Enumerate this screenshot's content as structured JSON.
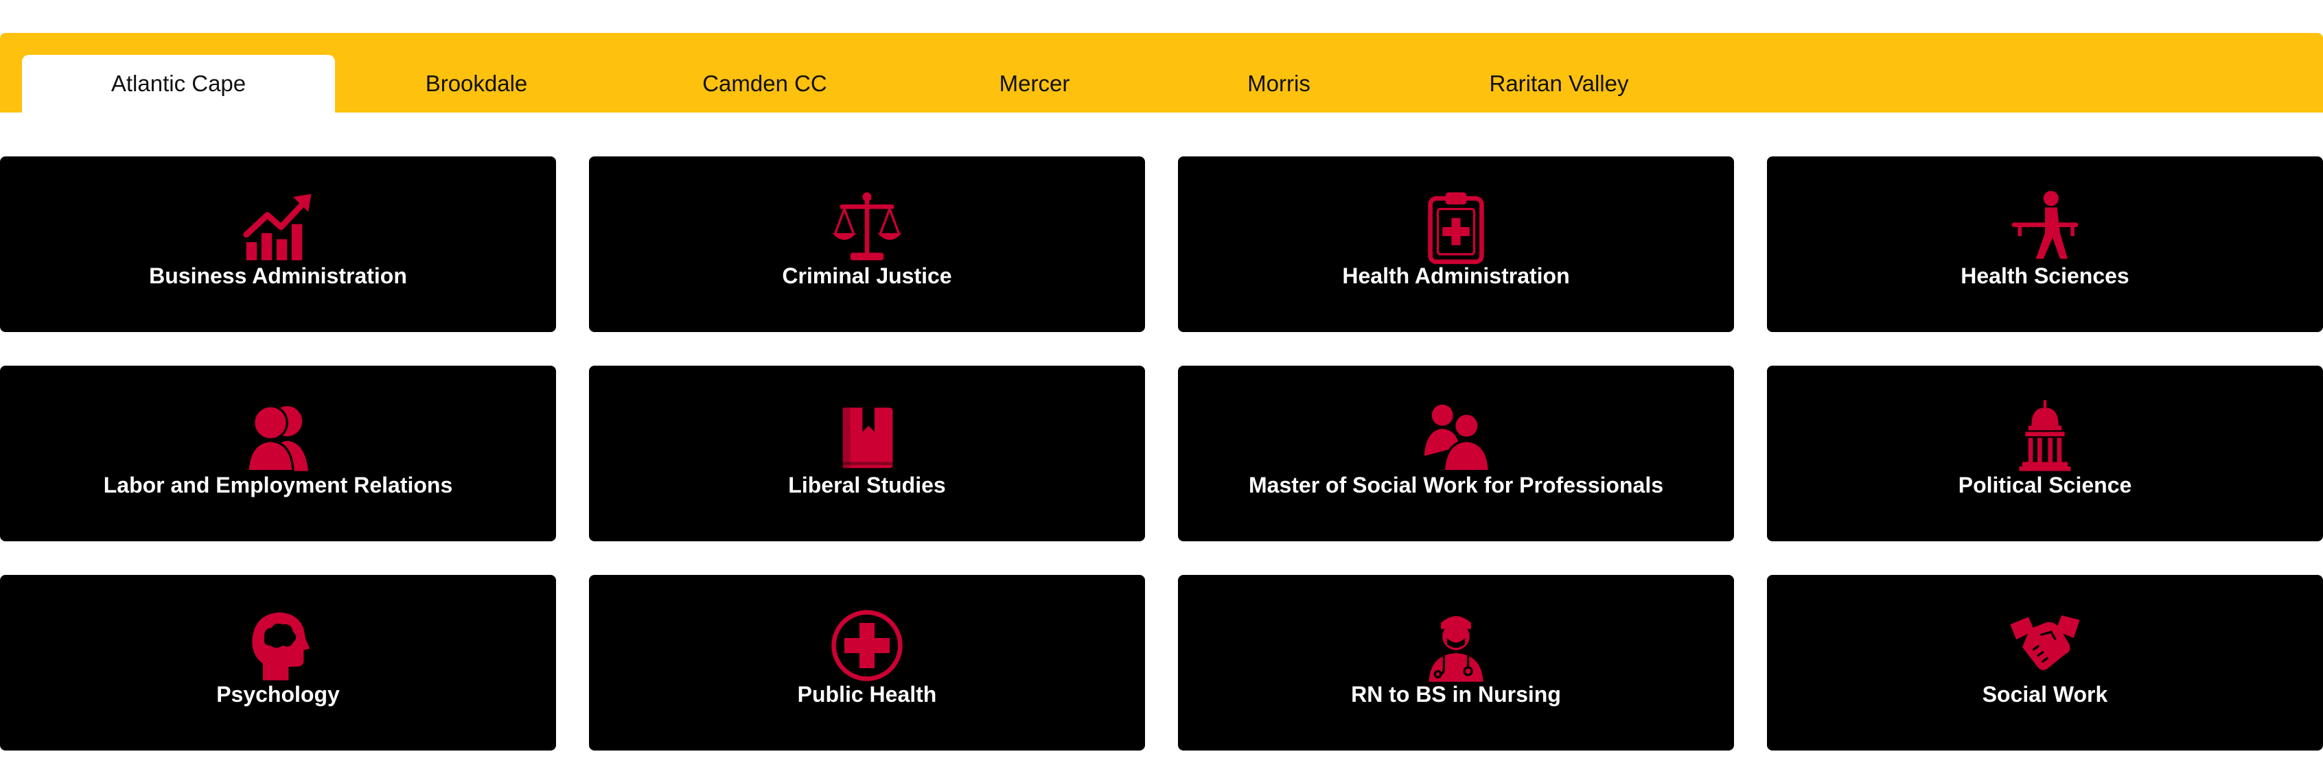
{
  "colors": {
    "tab_bar": "#fec10e",
    "card_bg": "#000000",
    "icon": "#cc0033",
    "label": "#ffffff"
  },
  "tabs": [
    {
      "label": "Atlantic Cape",
      "active": true
    },
    {
      "label": "Brookdale",
      "active": false
    },
    {
      "label": "Camden CC",
      "active": false
    },
    {
      "label": "Mercer",
      "active": false
    },
    {
      "label": "Morris",
      "active": false
    },
    {
      "label": "Raritan Valley",
      "active": false
    }
  ],
  "programs": [
    {
      "label": "Business Administration",
      "icon": "chart-growth-icon"
    },
    {
      "label": "Criminal Justice",
      "icon": "scales-icon"
    },
    {
      "label": "Health Administration",
      "icon": "clipboard-medical-icon"
    },
    {
      "label": "Health Sciences",
      "icon": "person-stretcher-icon"
    },
    {
      "label": "Labor and Employment Relations",
      "icon": "people-icon"
    },
    {
      "label": "Liberal Studies",
      "icon": "book-icon"
    },
    {
      "label": "Master of Social Work for Professionals",
      "icon": "people-group-icon"
    },
    {
      "label": "Political Science",
      "icon": "capitol-icon"
    },
    {
      "label": "Psychology",
      "icon": "head-brain-icon"
    },
    {
      "label": "Public Health",
      "icon": "medical-cross-icon"
    },
    {
      "label": "RN to BS in Nursing",
      "icon": "nurse-icon"
    },
    {
      "label": "Social Work",
      "icon": "handshake-icon"
    }
  ]
}
